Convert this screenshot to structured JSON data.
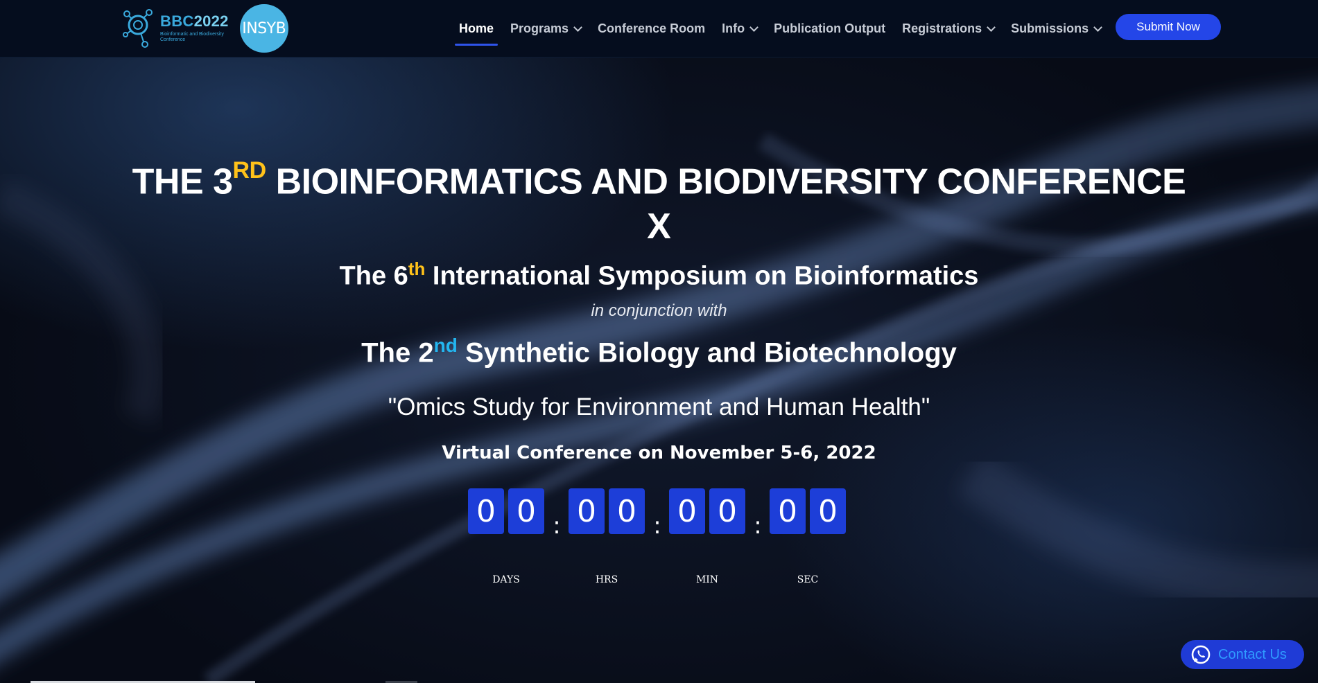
{
  "logo": {
    "bbc_title": "BBC",
    "bbc_year": "2022",
    "bbc_subtitle": "Bioinformatic and Biodiversity Conference",
    "insyb_text": "INSYB"
  },
  "nav": {
    "items": [
      {
        "label": "Home",
        "active": true,
        "dropdown": false
      },
      {
        "label": "Programs",
        "active": false,
        "dropdown": true
      },
      {
        "label": "Conference Room",
        "active": false,
        "dropdown": false
      },
      {
        "label": "Info",
        "active": false,
        "dropdown": true
      },
      {
        "label": "Publication Output",
        "active": false,
        "dropdown": false
      },
      {
        "label": "Registrations",
        "active": false,
        "dropdown": true
      },
      {
        "label": "Submissions",
        "active": false,
        "dropdown": true
      }
    ],
    "submit_label": "Submit Now"
  },
  "hero": {
    "line1_pre": "THE 3",
    "line1_sup": "RD",
    "line1_post": " BIOINFORMATICS AND BIODIVERSITY CONFERENCE",
    "x": "X",
    "line2_pre": "The 6",
    "line2_sup": "th",
    "line2_post": " International Symposium on Bioinformatics",
    "conjunction": "in conjunction with",
    "line3_pre": "The 2",
    "line3_sup": "nd",
    "line3_post": " Synthetic Biology and Biotechnology",
    "theme": "\"Omics Study for Environment and Human Health\"",
    "date": "Virtual Conference on November 5-6, 2022"
  },
  "countdown": {
    "days": [
      "0",
      "0"
    ],
    "hrs": [
      "0",
      "0"
    ],
    "min": [
      "0",
      "0"
    ],
    "sec": [
      "0",
      "0"
    ],
    "labels": {
      "days": "DAYS",
      "hrs": "HRS",
      "min": "MIN",
      "sec": "SEC"
    },
    "separator": ":"
  },
  "contact": {
    "label": "Contact Us"
  },
  "colors": {
    "accent_blue": "#2446e8",
    "sup_gold": "#ffc21a",
    "sup_cyan": "#23b6f0",
    "navbar_bg": "#050d1e"
  }
}
